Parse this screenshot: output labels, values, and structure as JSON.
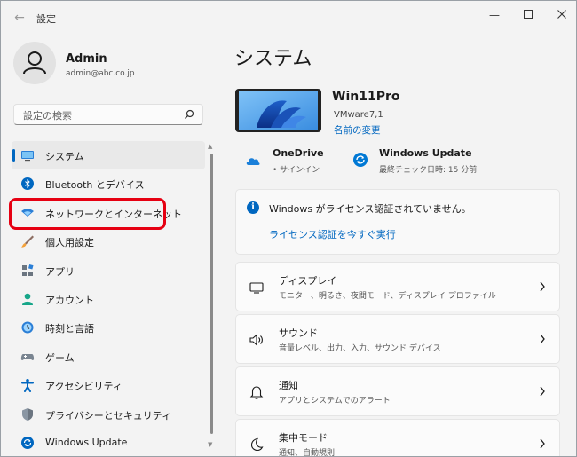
{
  "window": {
    "title": "設定"
  },
  "user": {
    "name": "Admin",
    "email": "admin@abc.co.jp"
  },
  "search": {
    "placeholder": "設定の検索"
  },
  "nav": {
    "items": [
      {
        "label": "システム",
        "icon": "system-icon"
      },
      {
        "label": "Bluetooth とデバイス",
        "icon": "bluetooth-icon"
      },
      {
        "label": "ネットワークとインターネット",
        "icon": "network-icon"
      },
      {
        "label": "個人用設定",
        "icon": "personalization-icon"
      },
      {
        "label": "アプリ",
        "icon": "apps-icon"
      },
      {
        "label": "アカウント",
        "icon": "account-icon"
      },
      {
        "label": "時刻と言語",
        "icon": "time-language-icon"
      },
      {
        "label": "ゲーム",
        "icon": "gaming-icon"
      },
      {
        "label": "アクセシビリティ",
        "icon": "accessibility-icon"
      },
      {
        "label": "プライバシーとセキュリティ",
        "icon": "privacy-shield-icon"
      },
      {
        "label": "Windows Update",
        "icon": "windows-update-icon"
      }
    ],
    "active_index": 0
  },
  "main": {
    "title": "システム",
    "device": {
      "name": "Win11Pro",
      "model": "VMware7,1",
      "rename_link": "名前の変更"
    },
    "quick_status": [
      {
        "title": "OneDrive",
        "subtitle": "• サインイン",
        "icon": "onedrive-cloud-icon"
      },
      {
        "title": "Windows Update",
        "subtitle": "最終チェック日時: 15 分前",
        "icon": "windows-update-icon"
      }
    ],
    "license": {
      "message": "Windows がライセンス認証されていません。",
      "link": "ライセンス認証を今すぐ実行"
    },
    "settings": [
      {
        "title": "ディスプレイ",
        "subtitle": "モニター、明るさ、夜間モード、ディスプレイ プロファイル",
        "icon": "display-icon"
      },
      {
        "title": "サウンド",
        "subtitle": "音量レベル、出力、入力、サウンド デバイス",
        "icon": "sound-icon"
      },
      {
        "title": "通知",
        "subtitle": "アプリとシステムでのアラート",
        "icon": "notification-bell-icon"
      },
      {
        "title": "集中モード",
        "subtitle": "通知、自動規則",
        "icon": "focus-moon-icon"
      }
    ]
  },
  "colors": {
    "accent": "#0067c0",
    "highlight": "#e60012",
    "background": "#f3f3f3"
  }
}
